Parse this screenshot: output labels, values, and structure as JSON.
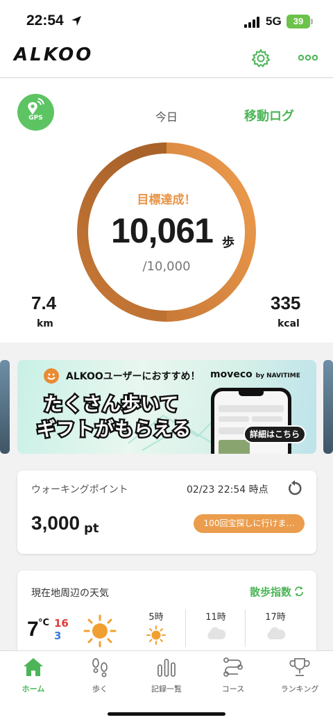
{
  "status_bar": {
    "time": "22:54",
    "network": "5G",
    "battery": "39"
  },
  "header": {
    "logo": "ALKOO"
  },
  "hero": {
    "gps_label": "GPS",
    "period": "今日",
    "move_log": "移動ログ",
    "goal_status": "目標達成！",
    "steps": "10,061",
    "steps_unit": "歩",
    "goal": "/10,000",
    "progress": 1.0,
    "distance": {
      "value": "7.4",
      "unit": "km"
    },
    "calories": {
      "value": "335",
      "unit": "kcal"
    },
    "colors": {
      "ring_light": "#ee9c4e",
      "ring_dark": "#b5692c",
      "accent": "#4cb557"
    }
  },
  "banner": {
    "title": "ALKOOユーザーにおすすめ！",
    "brand": "moveco",
    "brand_by": "by NAVITIME",
    "line1": "たくさん歩いて",
    "line2": "ギフトがもらえる",
    "detail": "詳細はこちら"
  },
  "points": {
    "label": "ウォーキングポイント",
    "timestamp": "02/23 22:54 時点",
    "value": "3,000",
    "unit": "pt",
    "action": "100回宝探しに行けま…"
  },
  "weather": {
    "label": "現在地周辺の天気",
    "walk_index": "散歩指数",
    "current_temp": "7",
    "deg": "°C",
    "high": "16",
    "low": "3",
    "hours": [
      {
        "time": "5時",
        "icon": "sun-icon"
      },
      {
        "time": "11時",
        "icon": "cloud-icon"
      },
      {
        "time": "17時",
        "icon": "cloud-icon"
      }
    ]
  },
  "tabs": [
    {
      "label": "ホーム",
      "icon": "home-icon",
      "active": true
    },
    {
      "label": "歩く",
      "icon": "footprints-icon",
      "active": false
    },
    {
      "label": "記録一覧",
      "icon": "bar-chart-icon",
      "active": false
    },
    {
      "label": "コース",
      "icon": "route-icon",
      "active": false
    },
    {
      "label": "ランキング",
      "icon": "trophy-icon",
      "active": false
    }
  ]
}
